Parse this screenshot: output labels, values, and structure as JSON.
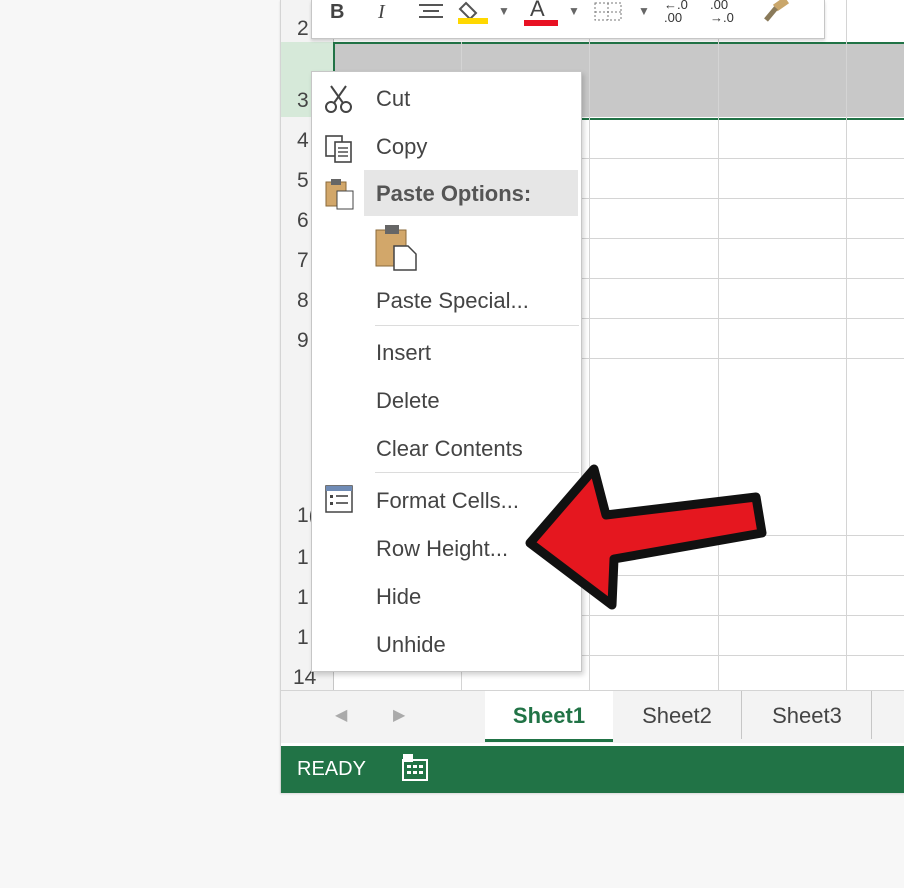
{
  "spreadsheet": {
    "row_labels": [
      "2",
      "3",
      "4",
      "5",
      "6",
      "7",
      "8",
      "9",
      "1(",
      "1",
      "1",
      "1",
      "14"
    ]
  },
  "mini_toolbar": {
    "bold_label": "B",
    "italic_label": "I",
    "font_color_label": "A",
    "font_color": "#e81123",
    "fill_color": "#ffd800",
    "increase_decimal_label": "←.0 .00",
    "decrease_decimal_label": ".00 →.0"
  },
  "context_menu": {
    "items": [
      {
        "label": "Cut",
        "icon": "scissors-icon"
      },
      {
        "label": "Copy",
        "icon": "copy-icon"
      },
      {
        "label": "Paste Options:",
        "icon": "clipboard-icon"
      },
      {
        "label": "Paste Special...",
        "icon": ""
      },
      {
        "label": "Insert",
        "icon": ""
      },
      {
        "label": "Delete",
        "icon": ""
      },
      {
        "label": "Clear Contents",
        "icon": ""
      },
      {
        "label": "Format Cells...",
        "icon": "format-cells-icon"
      },
      {
        "label": "Row Height...",
        "icon": ""
      },
      {
        "label": "Hide",
        "icon": ""
      },
      {
        "label": "Unhide",
        "icon": ""
      }
    ],
    "paste_option_icon": "paste-icon"
  },
  "sheet_tabs": [
    {
      "label": "Sheet1",
      "active": true
    },
    {
      "label": "Sheet2",
      "active": false
    },
    {
      "label": "Sheet3",
      "active": false
    }
  ],
  "status_bar": {
    "ready_label": "READY",
    "icon": "macro-record-icon"
  },
  "annotation": {
    "arrow_color": "#e5171f",
    "arrow_points_to": "Row Height..."
  },
  "colors": {
    "excel_green": "#217346",
    "selected_row_fill": "#c8c8c8",
    "selected_header": "#d6e9d9"
  }
}
